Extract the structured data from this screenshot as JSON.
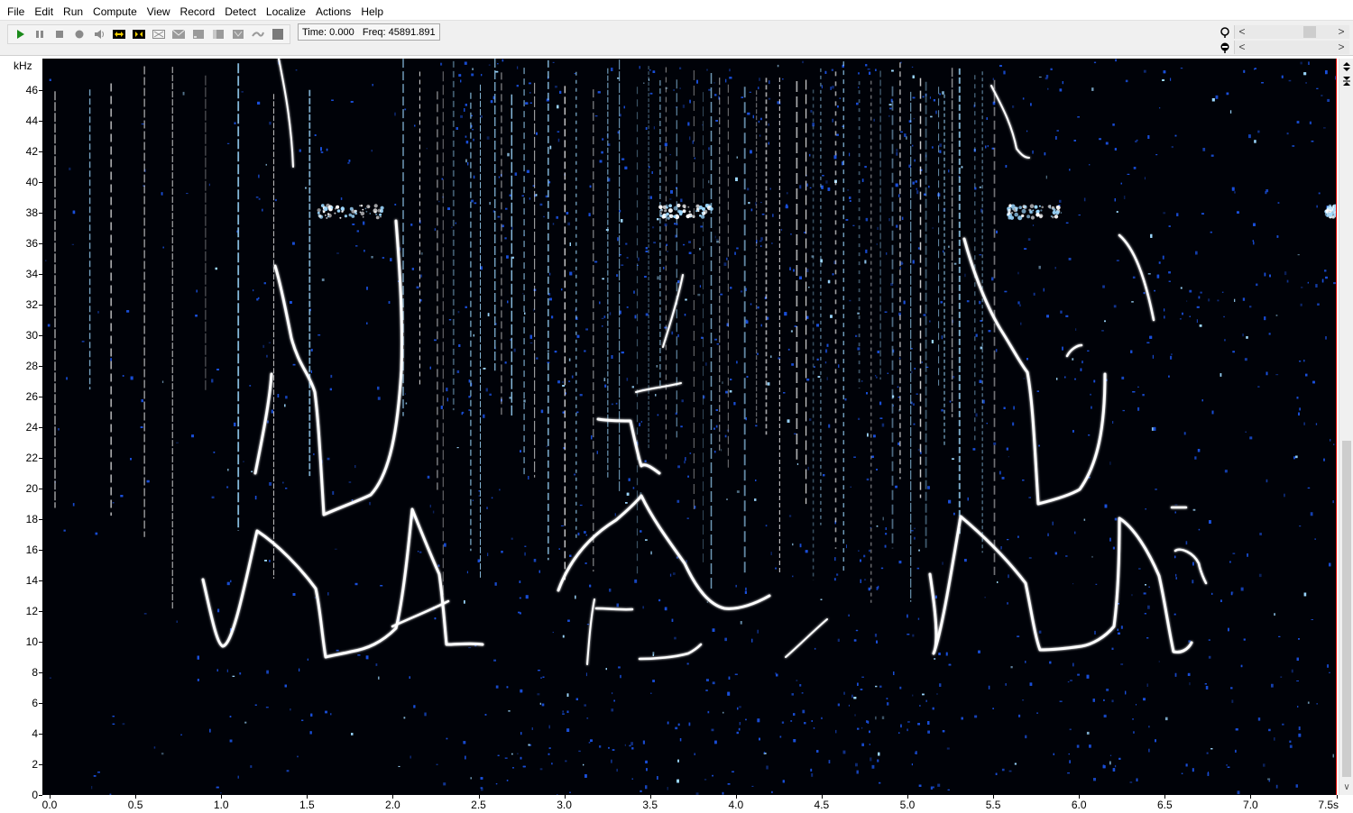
{
  "menu": {
    "items": [
      "File",
      "Edit",
      "Run",
      "Compute",
      "View",
      "Record",
      "Detect",
      "Localize",
      "Actions",
      "Help"
    ]
  },
  "toolbar": {
    "buttons": [
      "play-icon",
      "pause-icon",
      "stop-icon",
      "record-icon",
      "speaker-icon",
      "zoom-in-time-icon",
      "zoom-out-time-icon",
      "zoom-selection-icon",
      "envelope-icon",
      "waveform-icon",
      "marker-icon",
      "filter-icon",
      "detector-icon",
      "block-icon"
    ],
    "time_label": "Time:",
    "time_value": "0.000",
    "freq_label": "Freq:",
    "freq_value": "45891.891"
  },
  "scroll_controls": {
    "left_arrow": "<",
    "right_arrow": ">"
  },
  "spectrogram": {
    "y_axis_title": "kHz",
    "y_ticks": [
      "0",
      "2",
      "4",
      "6",
      "8",
      "10",
      "12",
      "14",
      "16",
      "18",
      "20",
      "22",
      "24",
      "26",
      "28",
      "30",
      "32",
      "34",
      "36",
      "38",
      "40",
      "42",
      "44",
      "46"
    ],
    "x_ticks": [
      "0.0",
      "0.5",
      "1.0",
      "1.5",
      "2.0",
      "2.5",
      "3.0",
      "3.5",
      "4.0",
      "4.5",
      "5.0",
      "5.5",
      "6.0",
      "6.5",
      "7.0",
      "7.5s"
    ],
    "colors": {
      "background": "#000208",
      "noise": "#1a4fd8",
      "trace": "#ffffff",
      "highlight": "#9cd8ff",
      "edge_marker": "#e00000"
    }
  }
}
